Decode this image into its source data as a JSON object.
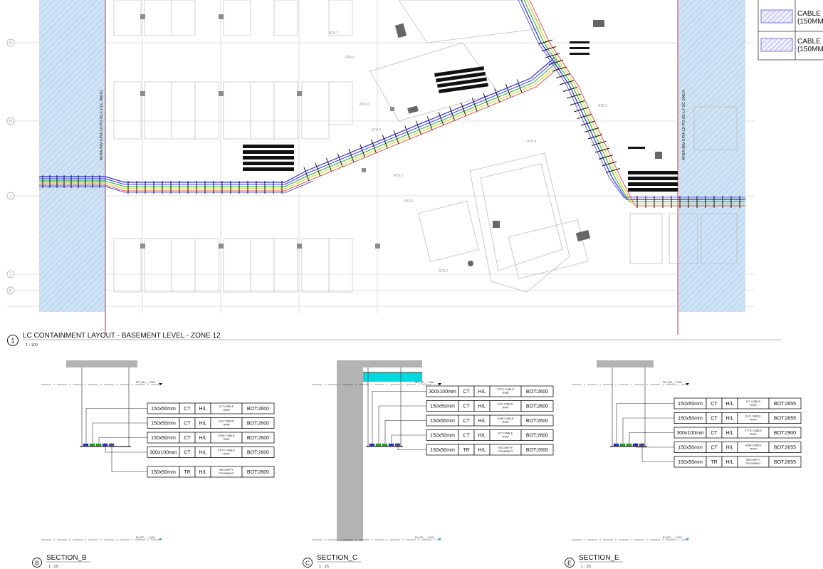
{
  "plan": {
    "title": "LC CONTAINMENT LAYOUT - BASEMENT LEVEL - ZONE 12",
    "number": "1",
    "scale": "1 : 100",
    "grid_labels": [
      "G",
      "H",
      "I",
      "J",
      "K"
    ],
    "sheet_ref_left": "AFBA-BW-SPM-12-PO-B1-LY-LC 00610",
    "sheet_ref_right": "AFBA-BW-SPM-12-PO-B1-LY-SC 00614",
    "room_tags": [
      "AT8.7",
      "AT8.8",
      "AT8.9",
      "AT8.6",
      "AT8.5",
      "AT8.1",
      "AT8.2",
      "AT8.4",
      "AT8.3"
    ]
  },
  "legend": {
    "items": [
      {
        "line1": "CABLE",
        "line2": "(150MM"
      },
      {
        "line1": "CABLE",
        "line2": "(150MM"
      }
    ],
    "colors": {
      "hatch": "#5b5bd6",
      "fill": "#e6e6ff"
    }
  },
  "sections": [
    {
      "id": "section-b",
      "marker": "B",
      "title": "SECTION_B",
      "scale": "1 : 25",
      "level_top": "AFC_B1_ - 3.800",
      "level_bottom": "B1_FFL_ - 3.400",
      "rows": [
        {
          "size": "150x50mm",
          "type": "CT",
          "hl": "H/L",
          "desc": "ICT CABLE TRAY",
          "bot": "BOT:2600"
        },
        {
          "size": "150x50mm",
          "type": "CT",
          "hl": "H/L",
          "desc": "ELV CABLE TRAY",
          "bot": "BOT:2600"
        },
        {
          "size": "150x50mm",
          "type": "CT",
          "hl": "H/L",
          "desc": "GSM CABLE TRAY",
          "bot": "BOT:2600"
        },
        {
          "size": "300x100mm",
          "type": "CT",
          "hl": "H/L",
          "desc": "FTTX CABLE TRAY",
          "bot": "BOT:2600"
        },
        {
          "size": "150x50mm",
          "type": "TR",
          "hl": "H/L",
          "desc": "SECURITY TRUNKING",
          "bot": "BOT:2600"
        }
      ]
    },
    {
      "id": "section-c",
      "marker": "C",
      "title": "SECTION_C",
      "scale": "1 : 25",
      "level_top": "AFC_B1_ - 3.800",
      "level_bottom": "B1_FFL_ - 3.400",
      "rows": [
        {
          "size": "300x100mm",
          "type": "CT",
          "hl": "H/L",
          "desc": "FTTX CABLE TRAY",
          "bot": "BOT:2600"
        },
        {
          "size": "150x50mm",
          "type": "CT",
          "hl": "H/L",
          "desc": "ELV CABLE TRAY",
          "bot": "BOT:2600"
        },
        {
          "size": "150x50mm",
          "type": "CT",
          "hl": "H/L",
          "desc": "GSM CABLE TRAY",
          "bot": "BOT:2600"
        },
        {
          "size": "150x50mm",
          "type": "CT",
          "hl": "H/L",
          "desc": "ICT CABLE TRAY",
          "bot": "BOT:2600"
        },
        {
          "size": "150x50mm",
          "type": "TR",
          "hl": "H/L",
          "desc": "SECURITY TRUNKING",
          "bot": "BOT:2600"
        }
      ]
    },
    {
      "id": "section-e",
      "marker": "E",
      "title": "SECTION_E",
      "scale": "1 : 25",
      "level_top": "AFC_B1_ - 3.800",
      "level_bottom": "B1_FFL_ - 3.400",
      "rows": [
        {
          "size": "150x50mm",
          "type": "CT",
          "hl": "H/L",
          "desc": "ICT CABLE TRAY",
          "bot": "BOT:2655"
        },
        {
          "size": "150x50mm",
          "type": "CT",
          "hl": "H/L",
          "desc": "ELV CABLE TRAY",
          "bot": "BOT:2655"
        },
        {
          "size": "300x100mm",
          "type": "CT",
          "hl": "H/L",
          "desc": "FTTX CABLE TRAY",
          "bot": "BOT:2900"
        },
        {
          "size": "150x50mm",
          "type": "CT",
          "hl": "H/L",
          "desc": "GSM CABLE TRAY",
          "bot": "BOT:2655"
        },
        {
          "size": "150x50mm",
          "type": "TR",
          "hl": "H/L",
          "desc": "SECURITY TRUNKING",
          "bot": "BOT:2655"
        }
      ]
    }
  ],
  "colors": {
    "hatch_zone": "#bcd8ef",
    "hatch_line": "#8fbde3",
    "match_line": "#e02020",
    "tray_blue": "#2a2ae0",
    "tray_green": "#20b020",
    "tray_yellow": "#e0d020",
    "tray_red": "#e03030",
    "cyan": "#00d8e0",
    "wall": "#b3b3b3"
  }
}
